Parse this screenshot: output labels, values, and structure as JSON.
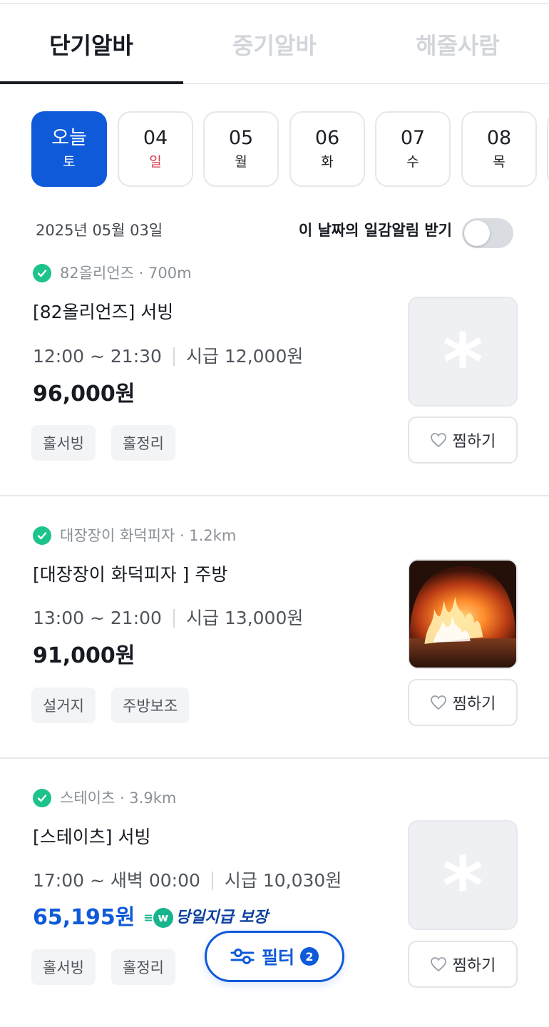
{
  "tabs": [
    {
      "label": "단기알바",
      "active": true
    },
    {
      "label": "중기알바",
      "active": false
    },
    {
      "label": "해줄사람",
      "active": false
    }
  ],
  "dates": [
    {
      "num": "오늘",
      "dow": "토",
      "active": true
    },
    {
      "num": "04",
      "dow": "일",
      "sunday": true
    },
    {
      "num": "05",
      "dow": "월"
    },
    {
      "num": "06",
      "dow": "화"
    },
    {
      "num": "07",
      "dow": "수"
    },
    {
      "num": "08",
      "dow": "목"
    }
  ],
  "date_header": {
    "date": "2025년 05월 03일",
    "alert_label": "이 날짜의 일감알림 받기",
    "alert_enabled": false
  },
  "jobs": [
    {
      "company": "82올리언즈 · 700m",
      "title": "[82올리언즈] 서빙",
      "time": "12:00 ~ 21:30",
      "wage": "시급 12,000원",
      "pay": "96,000원",
      "tags": [
        "홀서빙",
        "홀정리"
      ],
      "like_label": "찜하기",
      "thumb": "placeholder-asterisk"
    },
    {
      "company": "대장장이 화덕피자 · 1.2km",
      "title": "[대장장이 화덕피자 ] 주방",
      "time": "13:00 ~ 21:00",
      "wage": "시급 13,000원",
      "pay": "91,000원",
      "tags": [
        "설거지",
        "주방보조"
      ],
      "like_label": "찜하기",
      "thumb": "pizza-oven-photo"
    },
    {
      "company": "스테이츠 · 3.9km",
      "title": "[스테이츠] 서빙",
      "time": "17:00 ~ 새벽 00:00",
      "wage": "시급 10,030원",
      "pay": "65,195원",
      "pay_color": "#0f5ad9",
      "sameday_badge": {
        "icon_letter": "w",
        "label": "당일지급 보장"
      },
      "tags": [
        "홀서빙",
        "홀정리"
      ],
      "like_label": "찜하기",
      "thumb": "placeholder-asterisk"
    }
  ],
  "filter": {
    "label": "필터",
    "count": "2"
  },
  "colors": {
    "accent": "#0f5ad9",
    "verified": "#1cc38a",
    "sunday": "#d6394e",
    "sameday": "#16b58d"
  },
  "icons": {
    "verified": "verified-check-icon",
    "like": "heart-outline-icon",
    "filter": "sliders-icon"
  }
}
